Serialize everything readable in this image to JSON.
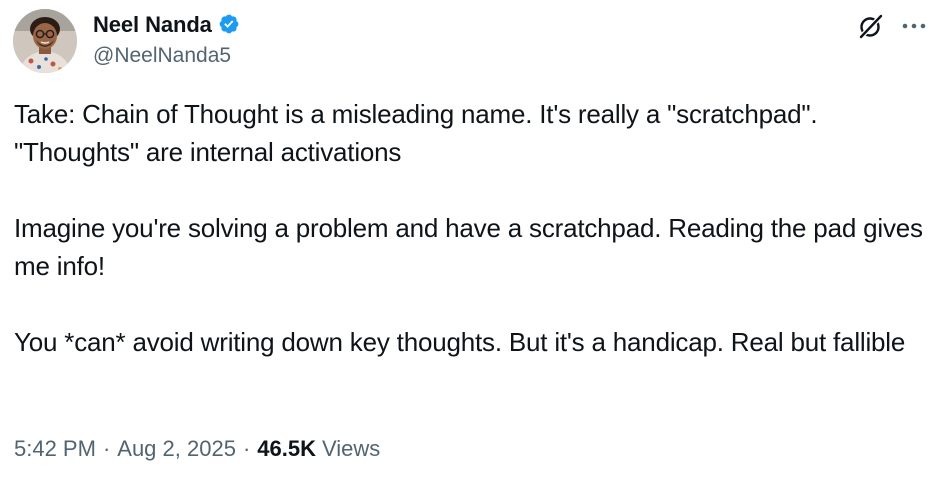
{
  "author": {
    "display_name": "Neel Nanda",
    "handle": "@NeelNanda5",
    "verified": true
  },
  "tweet": {
    "paragraphs": [
      "Take: Chain of Thought is a misleading name. It's really a \"scratchpad\". \"Thoughts\" are internal activations",
      "Imagine you're solving a problem and have a scratchpad. Reading the pad gives me info!",
      "You *can* avoid writing down key thoughts. But it's a handicap. Real but fallible"
    ]
  },
  "meta": {
    "time": "5:42 PM",
    "separator": "·",
    "date": "Aug 2, 2025",
    "views_count": "46.5K",
    "views_label": "Views"
  },
  "icons": {
    "verified": "verified-badge-icon",
    "grok": "grok-icon",
    "more": "more-options-icon"
  },
  "colors": {
    "verified_blue": "#1d9bf0",
    "text_primary": "#0f1419",
    "text_secondary": "#536471"
  }
}
